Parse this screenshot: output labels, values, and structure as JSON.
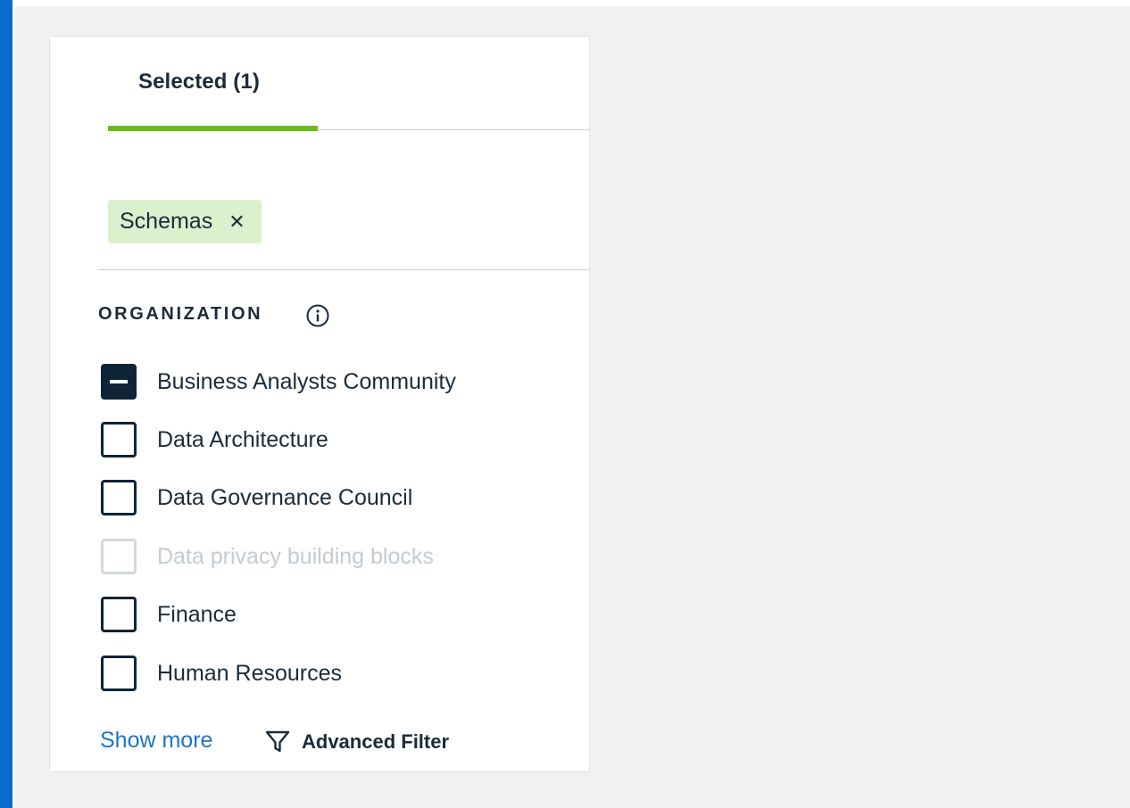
{
  "tabs": {
    "selected_label": "Selected (1)"
  },
  "chip": {
    "label": "Schemas",
    "close_glyph": "✕"
  },
  "section": {
    "title": "ORGANIZATION",
    "info_icon": "info-icon"
  },
  "options": [
    {
      "label": "Business Analysts Community",
      "state": "indeterminate"
    },
    {
      "label": "Data Architecture",
      "state": "unchecked"
    },
    {
      "label": "Data Governance Council",
      "state": "unchecked"
    },
    {
      "label": "Data privacy building blocks",
      "state": "disabled"
    },
    {
      "label": "Finance",
      "state": "unchecked"
    },
    {
      "label": "Human Resources",
      "state": "unchecked"
    }
  ],
  "footer": {
    "show_more_label": "Show more",
    "advanced_filter_label": "Advanced Filter",
    "filter_icon": "funnel-icon"
  },
  "colors": {
    "accent_bar": "#0a6ccc",
    "tab_underline": "#6cbb1a",
    "chip_bg": "#dbf0cc",
    "link": "#1e74c8",
    "checkbox_dark": "#0e2436"
  }
}
